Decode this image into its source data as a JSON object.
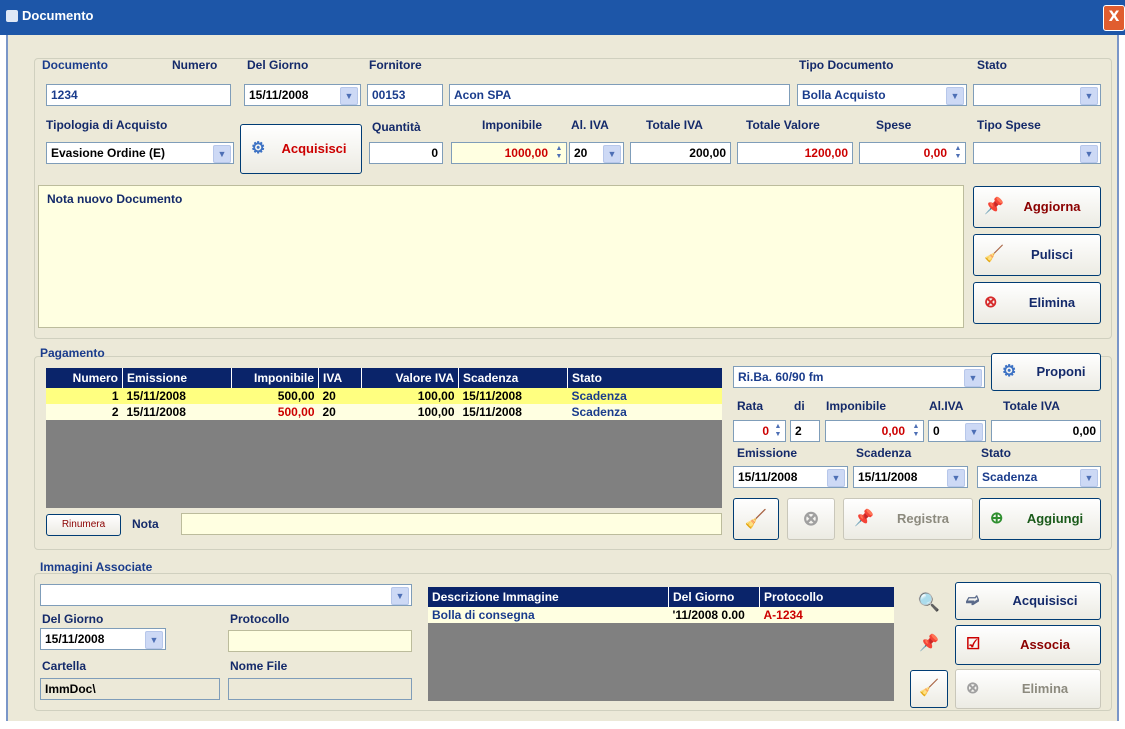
{
  "window": {
    "title": "Documento",
    "close_glyph": "X"
  },
  "header": {
    "labels": {
      "documento": "Documento",
      "numero": "Numero",
      "del_giorno": "Del Giorno",
      "fornitore": "Fornitore",
      "tipo_documento": "Tipo Documento",
      "stato": "Stato"
    },
    "documento_value": "1234",
    "del_giorno_value": "15/11/2008",
    "fornitore_code": "00153",
    "fornitore_name": "Acon SPA",
    "tipo_documento_value": "Bolla Acquisto",
    "stato_value": ""
  },
  "row2": {
    "labels": {
      "tipologia": "Tipologia di Acquisto",
      "quantita": "Quantità",
      "imponibile": "Imponibile",
      "al_iva": "Al. IVA",
      "totale_iva": "Totale IVA",
      "totale_valore": "Totale Valore",
      "spese": "Spese",
      "tipo_spese": "Tipo Spese"
    },
    "tipologia_value": "Evasione Ordine  (E)",
    "acquisisci_label": "Acquisisci",
    "quantita_value": "0",
    "imponibile_value": "1000,00",
    "al_iva_value": "20",
    "totale_iva_value": "200,00",
    "totale_valore_value": "1200,00",
    "spese_value": "0,00",
    "tipo_spese_value": ""
  },
  "note": {
    "text": "Nota nuovo Documento"
  },
  "doc_actions": {
    "aggiorna": "Aggiorna",
    "pulisci": "Pulisci",
    "elimina": "Elimina"
  },
  "pagamento": {
    "title": "Pagamento",
    "columns": [
      "Numero",
      "Emissione",
      "Imponibile",
      "IVA",
      "Valore IVA",
      "Scadenza",
      "Stato"
    ],
    "rows": [
      {
        "numero": "1",
        "emissione": "15/11/2008",
        "imponibile": "500,00",
        "iva": "20",
        "valore_iva": "100,00",
        "scadenza": "15/11/2008",
        "stato": "Scadenza"
      },
      {
        "numero": "2",
        "emissione": "15/11/2008",
        "imponibile": "500,00",
        "iva": "20",
        "valore_iva": "100,00",
        "scadenza": "15/11/2008",
        "stato": "Scadenza"
      }
    ],
    "rinumera": "Rinumera",
    "nota_label": "Nota",
    "nota_value": "",
    "method_value": "Ri.Ba. 60/90 fm",
    "proponi": "Proponi",
    "labels": {
      "rata": "Rata",
      "di": "di",
      "imponibile": "Imponibile",
      "al_iva": "Al.IVA",
      "totale_iva": "Totale IVA",
      "emissione": "Emissione",
      "scadenza": "Scadenza",
      "stato": "Stato"
    },
    "rata_value": "0",
    "di_value": "2",
    "imponibile_value": "0,00",
    "al_iva_value": "0",
    "totale_iva_value": "0,00",
    "emissione_value": "15/11/2008",
    "scadenza_value": "15/11/2008",
    "stato_value": "Scadenza",
    "registra": "Registra",
    "aggiungi": "Aggiungi"
  },
  "immagini": {
    "title": "Immagini Associate",
    "select_value": "",
    "labels": {
      "del_giorno": "Del Giorno",
      "protocollo": "Protocollo",
      "cartella": "Cartella",
      "nome_file": "Nome File"
    },
    "del_giorno_value": "15/11/2008",
    "protocollo_value": "",
    "cartella_value": "ImmDoc\\",
    "nome_file_value": "",
    "columns": [
      "Descrizione Immagine",
      "Del Giorno",
      "Protocollo"
    ],
    "rows": [
      {
        "descrizione": "Bolla di consegna",
        "del_giorno": "'11/2008 0.00",
        "protocollo": "A-1234"
      }
    ],
    "acquisisci": "Acquisisci",
    "associa": "Associa",
    "elimina": "Elimina"
  },
  "colors": {
    "title_bar": "#1d56a8",
    "grid_header": "#0a246a",
    "label_blue": "#1a3c8c",
    "value_red": "#cc0000",
    "note_yellow": "#ffffe1"
  },
  "icons": [
    "document-icon",
    "close-icon",
    "gear-icon",
    "pushpin-icon",
    "broom-icon",
    "delete-icon",
    "magnifier-icon",
    "scanner-icon",
    "checkbox-icon",
    "add-icon"
  ]
}
